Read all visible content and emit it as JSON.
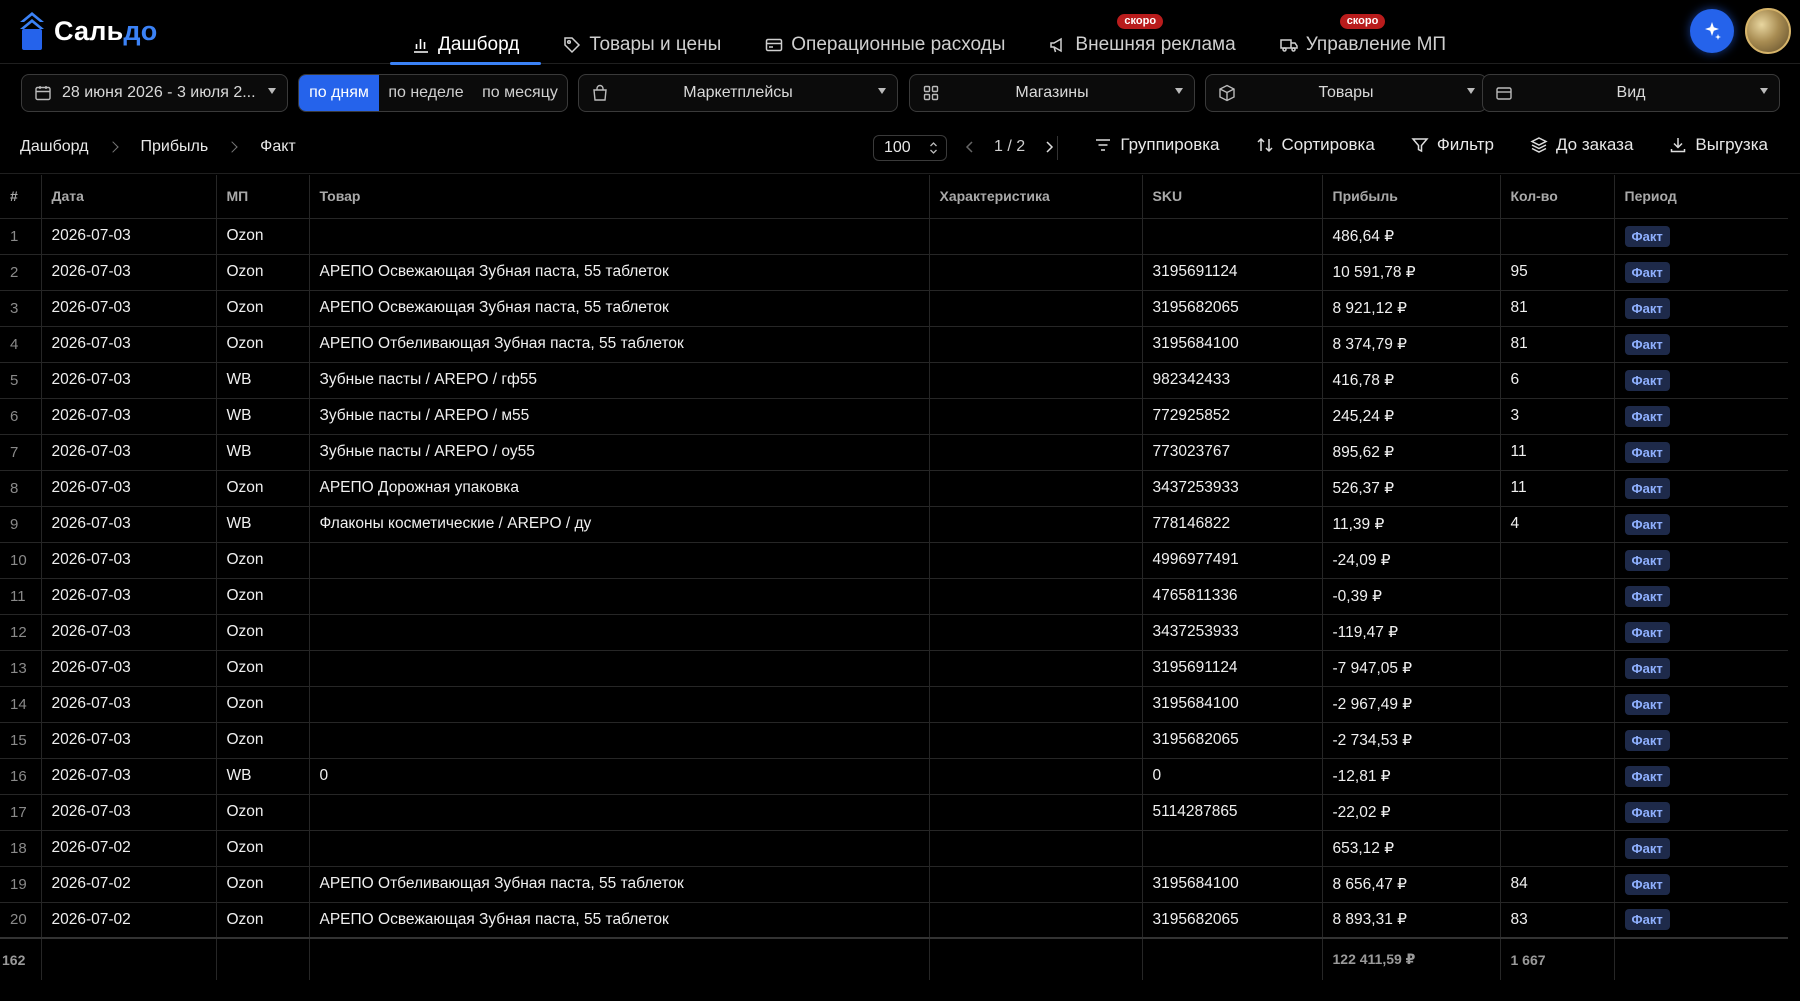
{
  "app": {
    "name_main": "Сальдо",
    "name_accent": "до",
    "name_prefix": "Саль"
  },
  "nav": [
    {
      "label": "Дашборд",
      "icon": "bar-chart-icon",
      "active": true,
      "badge": ""
    },
    {
      "label": "Товары и цены",
      "icon": "tag-icon",
      "active": false,
      "badge": ""
    },
    {
      "label": "Операционные расходы",
      "icon": "credit-card-icon",
      "active": false,
      "badge": ""
    },
    {
      "label": "Внешняя реклама",
      "icon": "megaphone-icon",
      "active": false,
      "badge": "скоро"
    },
    {
      "label": "Управление МП",
      "icon": "truck-icon",
      "active": false,
      "badge": "скоро"
    }
  ],
  "filters": {
    "date_range": "28 июня 2026 - 3 июля 2...",
    "granularity": [
      "по дням",
      "по неделе",
      "по месяцу"
    ],
    "granularity_active": "по дням",
    "marketplaces": "Маркетплейсы",
    "shops": "Магазины",
    "products": "Товары",
    "view": "Вид"
  },
  "breadcrumb": [
    "Дашборд",
    "Прибыль",
    "Факт"
  ],
  "pager": {
    "page_size": "100",
    "page": "1 / 2"
  },
  "tools": {
    "grouping": "Группировка",
    "sorting": "Сортировка",
    "filter": "Фильтр",
    "to_order": "До заказа",
    "export": "Выгрузка"
  },
  "table": {
    "columns": [
      "#",
      "Дата",
      "МП",
      "Товар",
      "Характеристика",
      "SKU",
      "Прибыль",
      "Кол-во",
      "Период"
    ],
    "rows": [
      [
        "1",
        "2026-07-03",
        "Ozon",
        "",
        "",
        "",
        "486,64 ₽",
        "",
        "Факт"
      ],
      [
        "2",
        "2026-07-03",
        "Ozon",
        "АРЕПО Освежающая Зубная паста, 55 таблеток",
        "",
        "3195691124",
        "10 591,78 ₽",
        "95",
        "Факт"
      ],
      [
        "3",
        "2026-07-03",
        "Ozon",
        "АРЕПО Освежающая Зубная паста, 55 таблеток",
        "",
        "3195682065",
        "8 921,12 ₽",
        "81",
        "Факт"
      ],
      [
        "4",
        "2026-07-03",
        "Ozon",
        "АРЕПО Отбеливающая Зубная паста, 55 таблеток",
        "",
        "3195684100",
        "8 374,79 ₽",
        "81",
        "Факт"
      ],
      [
        "5",
        "2026-07-03",
        "WB",
        "Зубные пасты / AREPO / гф55",
        "",
        "982342433",
        "416,78 ₽",
        "6",
        "Факт"
      ],
      [
        "6",
        "2026-07-03",
        "WB",
        "Зубные пасты / AREPO / м55",
        "",
        "772925852",
        "245,24 ₽",
        "3",
        "Факт"
      ],
      [
        "7",
        "2026-07-03",
        "WB",
        "Зубные пасты / AREPO / оу55",
        "",
        "773023767",
        "895,62 ₽",
        "11",
        "Факт"
      ],
      [
        "8",
        "2026-07-03",
        "Ozon",
        "АРЕПО Дорожная упаковка",
        "",
        "3437253933",
        "526,37 ₽",
        "11",
        "Факт"
      ],
      [
        "9",
        "2026-07-03",
        "WB",
        "Флаконы косметические / AREPO / ду",
        "",
        "778146822",
        "11,39 ₽",
        "4",
        "Факт"
      ],
      [
        "10",
        "2026-07-03",
        "Ozon",
        "",
        "",
        "4996977491",
        "-24,09 ₽",
        "",
        "Факт"
      ],
      [
        "11",
        "2026-07-03",
        "Ozon",
        "",
        "",
        "4765811336",
        "-0,39 ₽",
        "",
        "Факт"
      ],
      [
        "12",
        "2026-07-03",
        "Ozon",
        "",
        "",
        "3437253933",
        "-119,47 ₽",
        "",
        "Факт"
      ],
      [
        "13",
        "2026-07-03",
        "Ozon",
        "",
        "",
        "3195691124",
        "-7 947,05 ₽",
        "",
        "Факт"
      ],
      [
        "14",
        "2026-07-03",
        "Ozon",
        "",
        "",
        "3195684100",
        "-2 967,49 ₽",
        "",
        "Факт"
      ],
      [
        "15",
        "2026-07-03",
        "Ozon",
        "",
        "",
        "3195682065",
        "-2 734,53 ₽",
        "",
        "Факт"
      ],
      [
        "16",
        "2026-07-03",
        "WB",
        "0",
        "",
        "0",
        "-12,81 ₽",
        "",
        "Факт"
      ],
      [
        "17",
        "2026-07-03",
        "Ozon",
        "",
        "",
        "5114287865",
        "-22,02 ₽",
        "",
        "Факт"
      ],
      [
        "18",
        "2026-07-02",
        "Ozon",
        "",
        "",
        "",
        "653,12 ₽",
        "",
        "Факт"
      ],
      [
        "19",
        "2026-07-02",
        "Ozon",
        "АРЕПО Отбеливающая Зубная паста, 55 таблеток",
        "",
        "3195684100",
        "8 656,47 ₽",
        "84",
        "Факт"
      ],
      [
        "20",
        "2026-07-02",
        "Ozon",
        "АРЕПО Освежающая Зубная паста, 55 таблеток",
        "",
        "3195682065",
        "8 893,31 ₽",
        "83",
        "Факт"
      ]
    ],
    "totals": {
      "count": "162",
      "profit": "122 411,59 ₽",
      "qty": "1 667"
    }
  },
  "colors": {
    "accent": "#2563eb",
    "badge_soon": "#b91c1c",
    "period_badge_bg": "#1e2a4a",
    "period_badge_fg": "#8fb0ff"
  }
}
